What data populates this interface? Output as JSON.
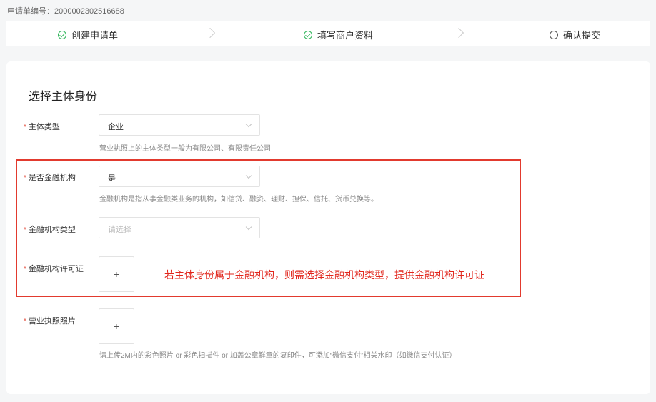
{
  "header": {
    "application_no": "申请单编号：2000002302516688"
  },
  "steps": [
    {
      "label": "创建申请单",
      "state": "done"
    },
    {
      "label": "填写商户资料",
      "state": "done"
    },
    {
      "label": "确认提交",
      "state": "todo"
    }
  ],
  "form": {
    "section_title": "选择主体身份",
    "required_mark": "*",
    "subject_type": {
      "label": "主体类型",
      "value": "企业",
      "hint": "营业执照上的主体类型一般为有限公司、有限责任公司"
    },
    "is_financial": {
      "label": "是否金融机构",
      "value": "是",
      "hint": "金融机构是指从事金融类业务的机构，如信贷、融资、理财、担保、信托、货币兑换等。"
    },
    "financial_type": {
      "label": "金融机构类型",
      "placeholder": "请选择"
    },
    "financial_license": {
      "label": "金融机构许可证",
      "upload_symbol": "+"
    },
    "business_license": {
      "label": "营业执照照片",
      "upload_symbol": "+",
      "hint": "请上传2M内的彩色照片 or 彩色扫描件 or 加盖公章鲜章的复印件，可添加“微信支付”相关水印（如微信支付认证）"
    }
  },
  "annotation": {
    "text": "若主体身份属于金融机构，则需选择金融机构类型，提供金融机构许可证",
    "color": "#e1251b"
  },
  "colors": {
    "success": "#2fb65a",
    "required": "#e34d3d",
    "highlight": "#e23a2e"
  }
}
